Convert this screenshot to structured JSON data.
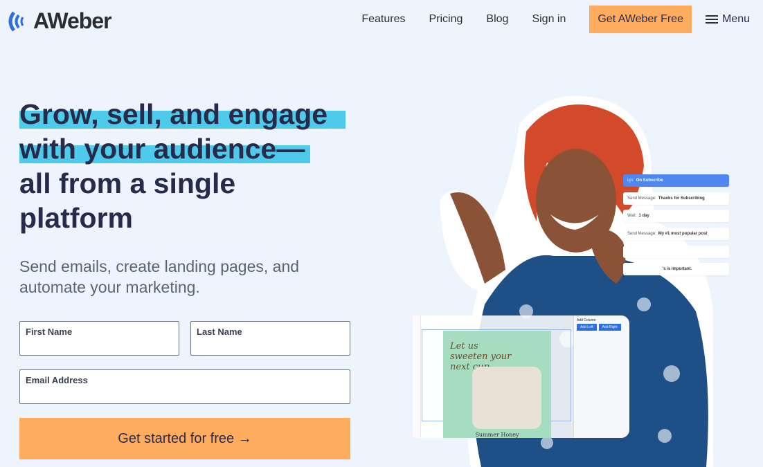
{
  "brand": {
    "name": "AWeber"
  },
  "nav": {
    "items": [
      "Features",
      "Pricing",
      "Blog",
      "Sign in"
    ],
    "cta": "Get AWeber Free",
    "menu": "Menu"
  },
  "hero": {
    "headline_lines": [
      "Grow, sell, and engage",
      "with your audience—",
      "all from a single",
      "platform"
    ],
    "subtitle": "Send emails, create landing pages, and automate your marketing."
  },
  "form": {
    "first_name": "First Name",
    "last_name": "Last Name",
    "email": "Email Address",
    "submit": "Get started for free →"
  },
  "workflow": {
    "cards": [
      {
        "label": "ign:",
        "value": "On Subscribe"
      },
      {
        "label": "Send Message:",
        "value": "Thanks for Subscribing"
      },
      {
        "label": "Wait:",
        "value": "1 day"
      },
      {
        "label": "Send Message:",
        "value": "My #1 most popular post"
      },
      {
        "label": "",
        "value": ""
      },
      {
        "label": "",
        "value": "'s is important."
      }
    ]
  },
  "editor": {
    "promo": "Let us sweeten your next cup",
    "footer": "Summer Honey",
    "add_column": "Add Column",
    "add_left": "Add Left",
    "add_right": "Add Right"
  },
  "colors": {
    "accent": "#ffac5f",
    "highlight": "#4ecbeb",
    "brand_blue": "#2d6fe0",
    "navy": "#272b4b"
  }
}
